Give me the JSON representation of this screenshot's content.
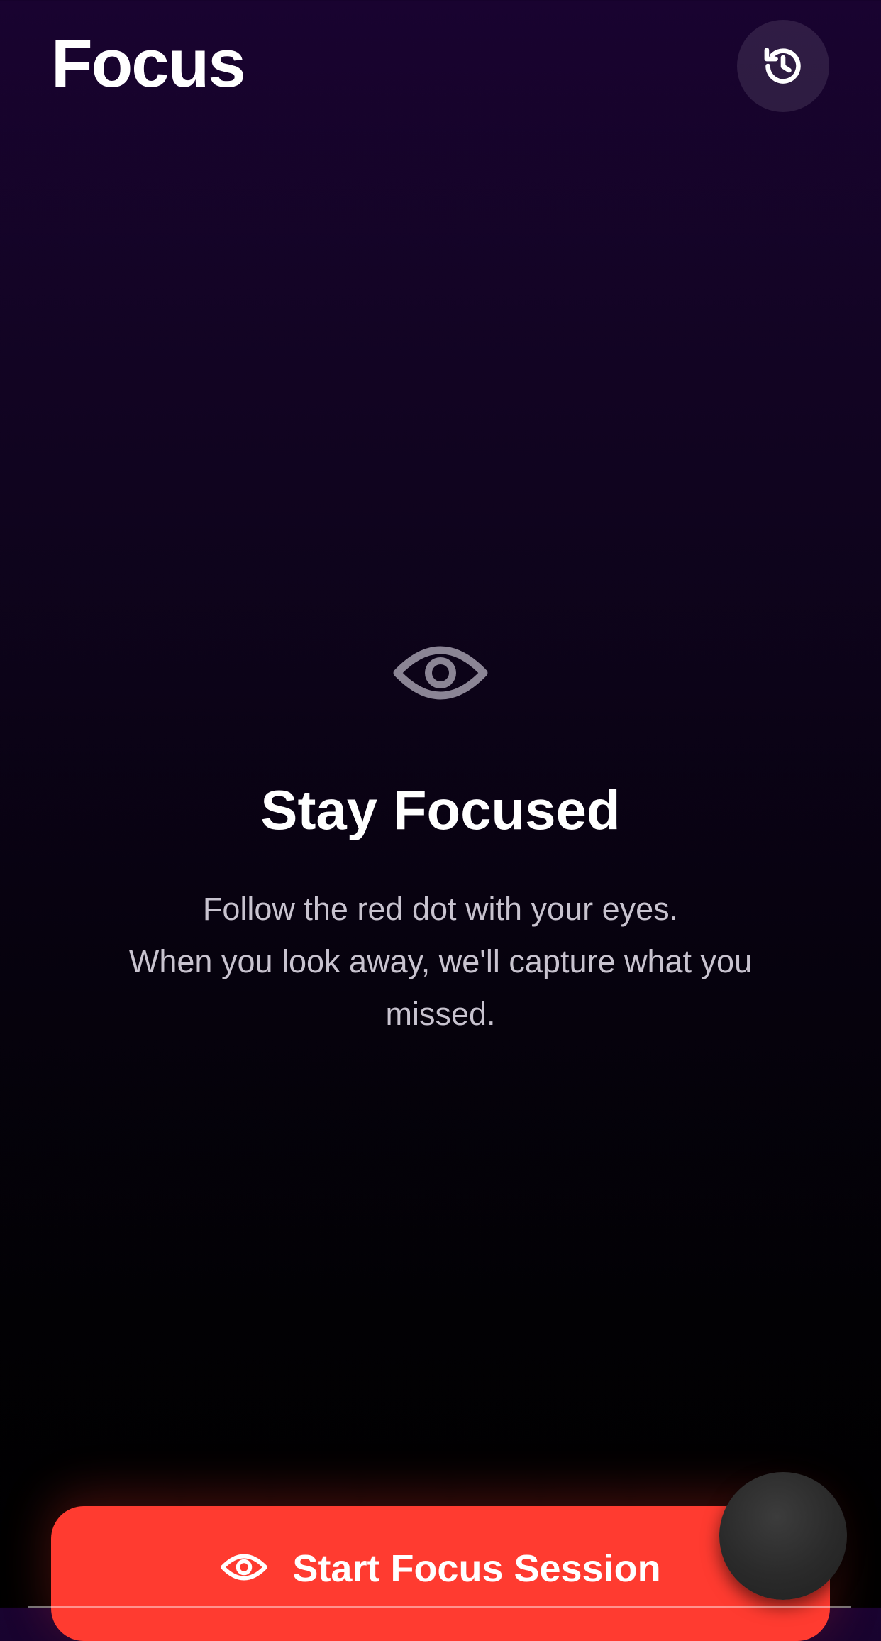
{
  "header": {
    "title": "Focus",
    "history_icon": "history-clock-icon"
  },
  "main": {
    "icon": "eye-icon",
    "headline": "Stay Focused",
    "description_lines": [
      "Follow the red dot with your eyes.",
      "When you look away, we'll capture what you",
      "missed."
    ]
  },
  "action": {
    "label": "Start Focus Session",
    "icon": "eye-icon"
  },
  "colors": {
    "accent": "#ff3b30",
    "background_top": "#190330",
    "background_bottom": "#000000"
  }
}
